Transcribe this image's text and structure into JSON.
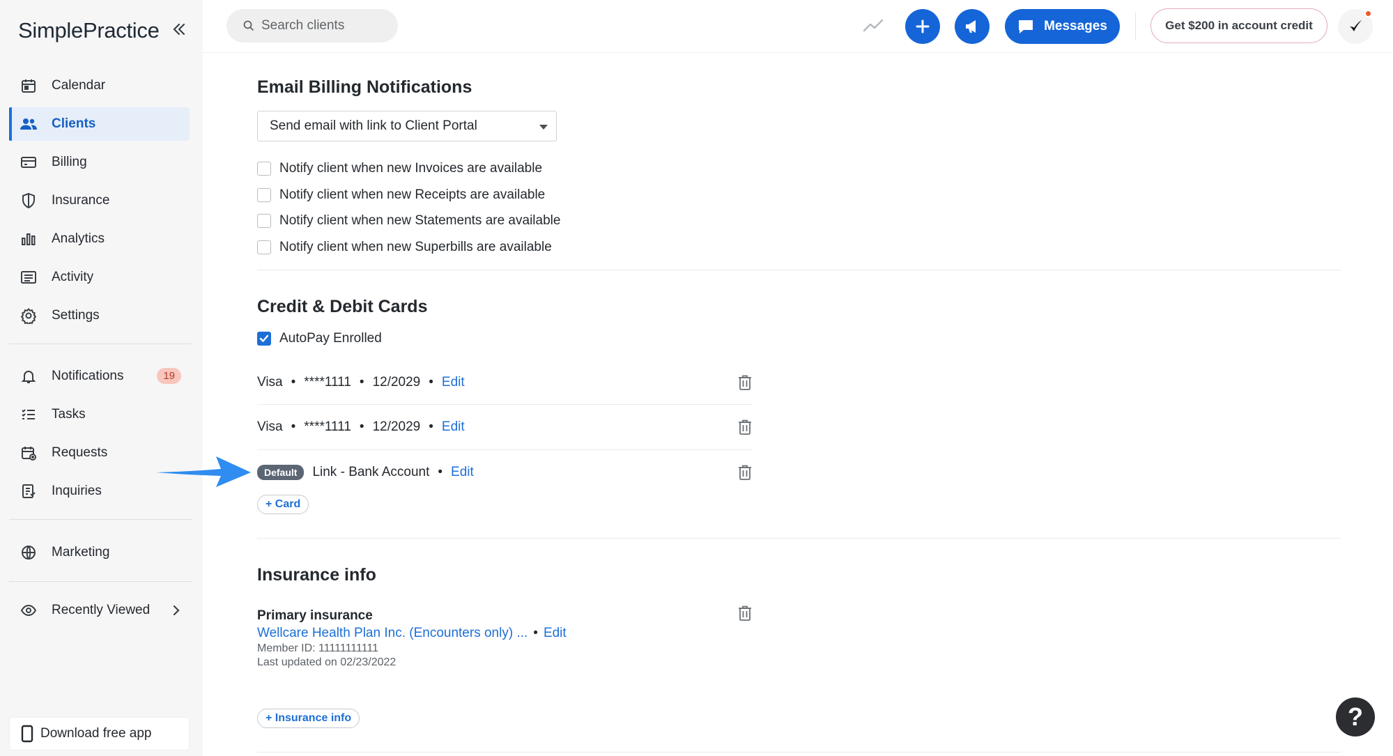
{
  "app": {
    "logo": "SimplePractice"
  },
  "sidebar": {
    "items": [
      {
        "label": "Calendar",
        "icon": "calendar-icon"
      },
      {
        "label": "Clients",
        "icon": "users-icon",
        "active": true
      },
      {
        "label": "Billing",
        "icon": "credit-card-icon"
      },
      {
        "label": "Insurance",
        "icon": "shield-icon"
      },
      {
        "label": "Analytics",
        "icon": "bar-chart-icon"
      },
      {
        "label": "Activity",
        "icon": "list-icon"
      },
      {
        "label": "Settings",
        "icon": "gear-icon"
      }
    ],
    "secondary": [
      {
        "label": "Notifications",
        "icon": "bell-icon",
        "badge": "19"
      },
      {
        "label": "Tasks",
        "icon": "checklist-icon"
      },
      {
        "label": "Requests",
        "icon": "calendar-plus-icon"
      },
      {
        "label": "Inquiries",
        "icon": "document-icon"
      }
    ],
    "marketing": {
      "label": "Marketing",
      "icon": "globe-icon"
    },
    "recent": {
      "label": "Recently Viewed",
      "icon": "eye-icon"
    },
    "download": {
      "label": "Download free app",
      "icon": "phone-icon"
    }
  },
  "topbar": {
    "search_placeholder": "Search clients",
    "messages_label": "Messages",
    "credit_label": "Get $200 in account credit"
  },
  "email_billing": {
    "title": "Email Billing Notifications",
    "select_value": "Send email with link to Client Portal",
    "options": [
      {
        "label": "Notify client when new Invoices are available",
        "checked": false
      },
      {
        "label": "Notify client when new Receipts are available",
        "checked": false
      },
      {
        "label": "Notify client when new Statements are available",
        "checked": false
      },
      {
        "label": "Notify client when new Superbills are available",
        "checked": false
      }
    ]
  },
  "cards": {
    "title": "Credit & Debit Cards",
    "autopay_label": "AutoPay Enrolled",
    "autopay_checked": true,
    "rows": [
      {
        "brand": "Visa",
        "number": "****1111",
        "expiry": "12/2029",
        "edit": "Edit"
      },
      {
        "brand": "Visa",
        "number": "****1111",
        "expiry": "12/2029",
        "edit": "Edit"
      }
    ],
    "default_tag": "Default",
    "bank_label": "Link - Bank Account",
    "bank_edit": "Edit",
    "add_label": "+ Card"
  },
  "insurance": {
    "title": "Insurance info",
    "primary_label": "Primary insurance",
    "plan_link": "Wellcare Health Plan Inc. (Encounters only) ...",
    "edit": "Edit",
    "member_id": "Member ID: 11111111111",
    "updated": "Last updated on 02/23/2022",
    "add_label": "+ Insurance info"
  },
  "help": {
    "label": "?"
  },
  "colors": {
    "accent": "#1565d8",
    "link": "#1d6fd6",
    "badge_bg": "#f7c6bd",
    "arrow": "#2f8cf0"
  }
}
